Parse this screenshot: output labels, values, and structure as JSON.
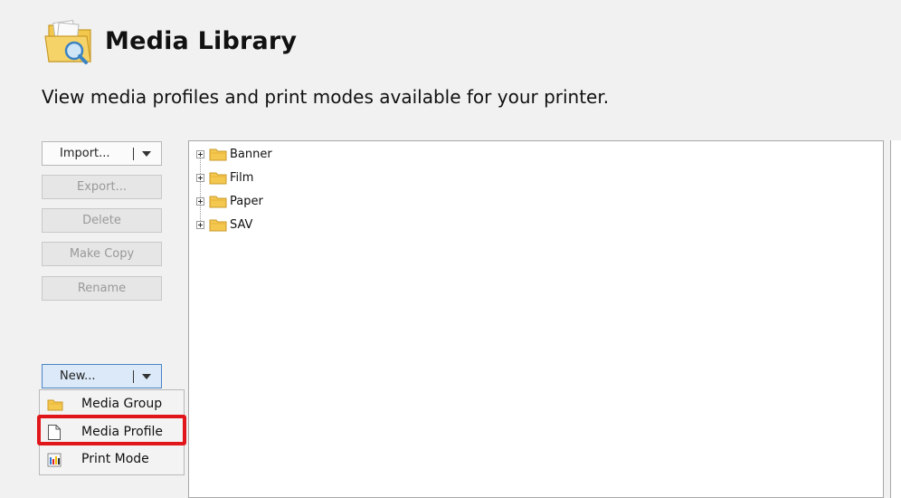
{
  "header": {
    "title": "Media Library",
    "subtitle": "View media profiles and print modes available for your printer."
  },
  "actions": {
    "import_label": "Import...",
    "export_label": "Export...",
    "delete_label": "Delete",
    "make_copy_label": "Make Copy",
    "rename_label": "Rename",
    "new_label": "New..."
  },
  "new_menu": {
    "items": [
      {
        "label": "Media Group",
        "icon": "folder-icon"
      },
      {
        "label": "Media Profile",
        "icon": "document-icon",
        "highlighted": true
      },
      {
        "label": "Print Mode",
        "icon": "print-mode-icon"
      }
    ]
  },
  "tree": {
    "items": [
      {
        "label": "Banner",
        "icon": "folder-icon",
        "expandable": true
      },
      {
        "label": "Film",
        "icon": "folder-icon",
        "expandable": true
      },
      {
        "label": "Paper",
        "icon": "folder-icon",
        "expandable": true
      },
      {
        "label": "SAV",
        "icon": "folder-icon",
        "expandable": true
      }
    ]
  },
  "colors": {
    "highlight": "#e0161a",
    "folder": "#f4c84f",
    "active_button_border": "#4a85c5"
  }
}
